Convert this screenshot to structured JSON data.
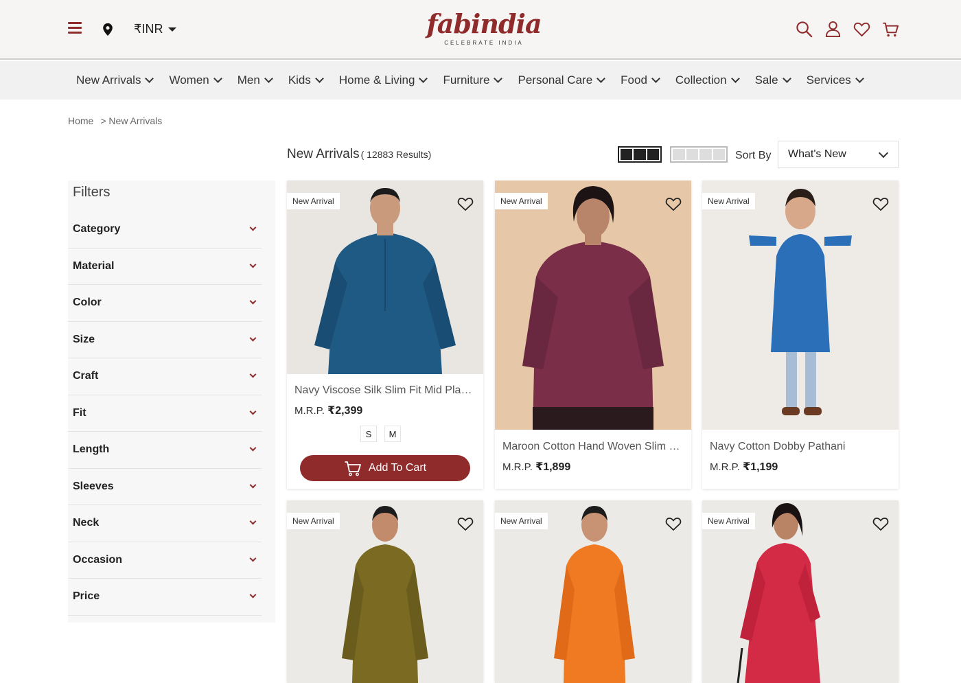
{
  "header": {
    "currency": "₹INR",
    "logo_text": "fabindia",
    "logo_tagline": "CELEBRATE INDIA",
    "icons": [
      "menu-icon",
      "location-pin-icon",
      "search-icon",
      "user-icon",
      "heart-icon",
      "cart-icon"
    ]
  },
  "nav": {
    "items": [
      {
        "label": "New Arrivals"
      },
      {
        "label": "Women"
      },
      {
        "label": "Men"
      },
      {
        "label": "Kids"
      },
      {
        "label": "Home & Living"
      },
      {
        "label": "Furniture"
      },
      {
        "label": "Personal Care"
      },
      {
        "label": "Food"
      },
      {
        "label": "Collection"
      },
      {
        "label": "Sale"
      },
      {
        "label": "Services"
      }
    ]
  },
  "breadcrumb": {
    "home": "Home",
    "current": "> New Arrivals"
  },
  "results": {
    "title": "New Arrivals",
    "count": "( 12883 Results)"
  },
  "sort": {
    "label": "Sort By",
    "value": "What's New"
  },
  "filters": {
    "title": "Filters",
    "items": [
      "Category",
      "Material",
      "Color",
      "Size",
      "Craft",
      "Fit",
      "Length",
      "Sleeves",
      "Neck",
      "Occasion",
      "Price"
    ]
  },
  "products": [
    {
      "badge": "New Arrival",
      "name": "Navy Viscose Silk Slim Fit Mid Placket Kurta",
      "mrp_label": "M.R.P.",
      "price": "₹2,399",
      "sizes": [
        "S",
        "M"
      ],
      "cta": "Add To Cart",
      "bg": "#e9e6e2",
      "garment": "#1f5a85"
    },
    {
      "badge": "New Arrival",
      "name": "Maroon Cotton Hand Woven Slim Fit Kurti",
      "mrp_label": "M.R.P.",
      "price": "₹1,899",
      "bg": "#e6c7a8",
      "garment": "#7a2e47"
    },
    {
      "badge": "New Arrival",
      "name": "Navy Cotton Dobby Pathani",
      "mrp_label": "M.R.P.",
      "price": "₹1,199",
      "bg": "#eeebe6",
      "garment": "#2a6fb8"
    },
    {
      "badge": "New Arrival",
      "bg": "#eceae6",
      "garment": "#7a6a22"
    },
    {
      "badge": "New Arrival",
      "bg": "#eceae6",
      "garment": "#f07a22"
    },
    {
      "badge": "New Arrival",
      "bg": "#eceae6",
      "garment": "#d32a45"
    }
  ],
  "colors": {
    "brand": "#8f2b2b"
  }
}
